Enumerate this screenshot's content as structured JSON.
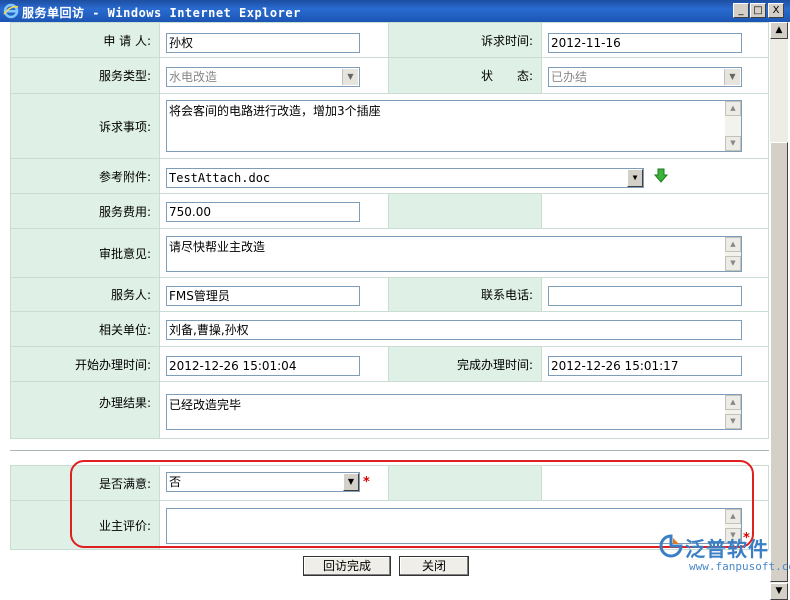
{
  "window": {
    "title": "服务单回访 - Windows Internet Explorer",
    "minimize_glyph": "_",
    "maximize_glyph": "□",
    "close_glyph": "X"
  },
  "form": {
    "applicant_label": "申 请 人:",
    "applicant_value": "孙权",
    "request_time_label": "诉求时间:",
    "request_time_value": "2012-11-16",
    "service_type_label": "服务类型:",
    "service_type_value": "水电改造",
    "status_label": "状　　态:",
    "status_value": "已办结",
    "request_item_label": "诉求事项:",
    "request_item_value": "将会客间的电路进行改造，增加3个插座",
    "attachment_label": "参考附件:",
    "attachment_value": "TestAttach.doc",
    "service_fee_label": "服务费用:",
    "service_fee_value": "750.00",
    "approval_label": "审批意见:",
    "approval_value": "请尽快帮业主改造",
    "server_label": "服务人:",
    "server_value": "FMS管理员",
    "phone_label": "联系电话:",
    "phone_value": "",
    "related_unit_label": "相关单位:",
    "related_unit_value": "刘备,曹操,孙权",
    "start_time_label": "开始办理时间:",
    "start_time_value": "2012-12-26 15:01:04",
    "finish_time_label": "完成办理时间:",
    "finish_time_value": "2012-12-26 15:01:17",
    "result_label": "办理结果:",
    "result_value": "已经改造完毕",
    "satisfied_label": "是否满意:",
    "satisfied_value": "否",
    "owner_review_label": "业主评价:",
    "owner_review_value": "",
    "required_mark": "*"
  },
  "buttons": {
    "complete_label": "回访完成",
    "close_label": "关闭"
  },
  "watermark": {
    "brand": "泛普软件",
    "url": "www.fanpusoft.com"
  },
  "colors": {
    "label_bg": "#dff0e6",
    "title_bar": "#2a6bd0",
    "highlight": "#e02020",
    "required": "#dd0000"
  }
}
